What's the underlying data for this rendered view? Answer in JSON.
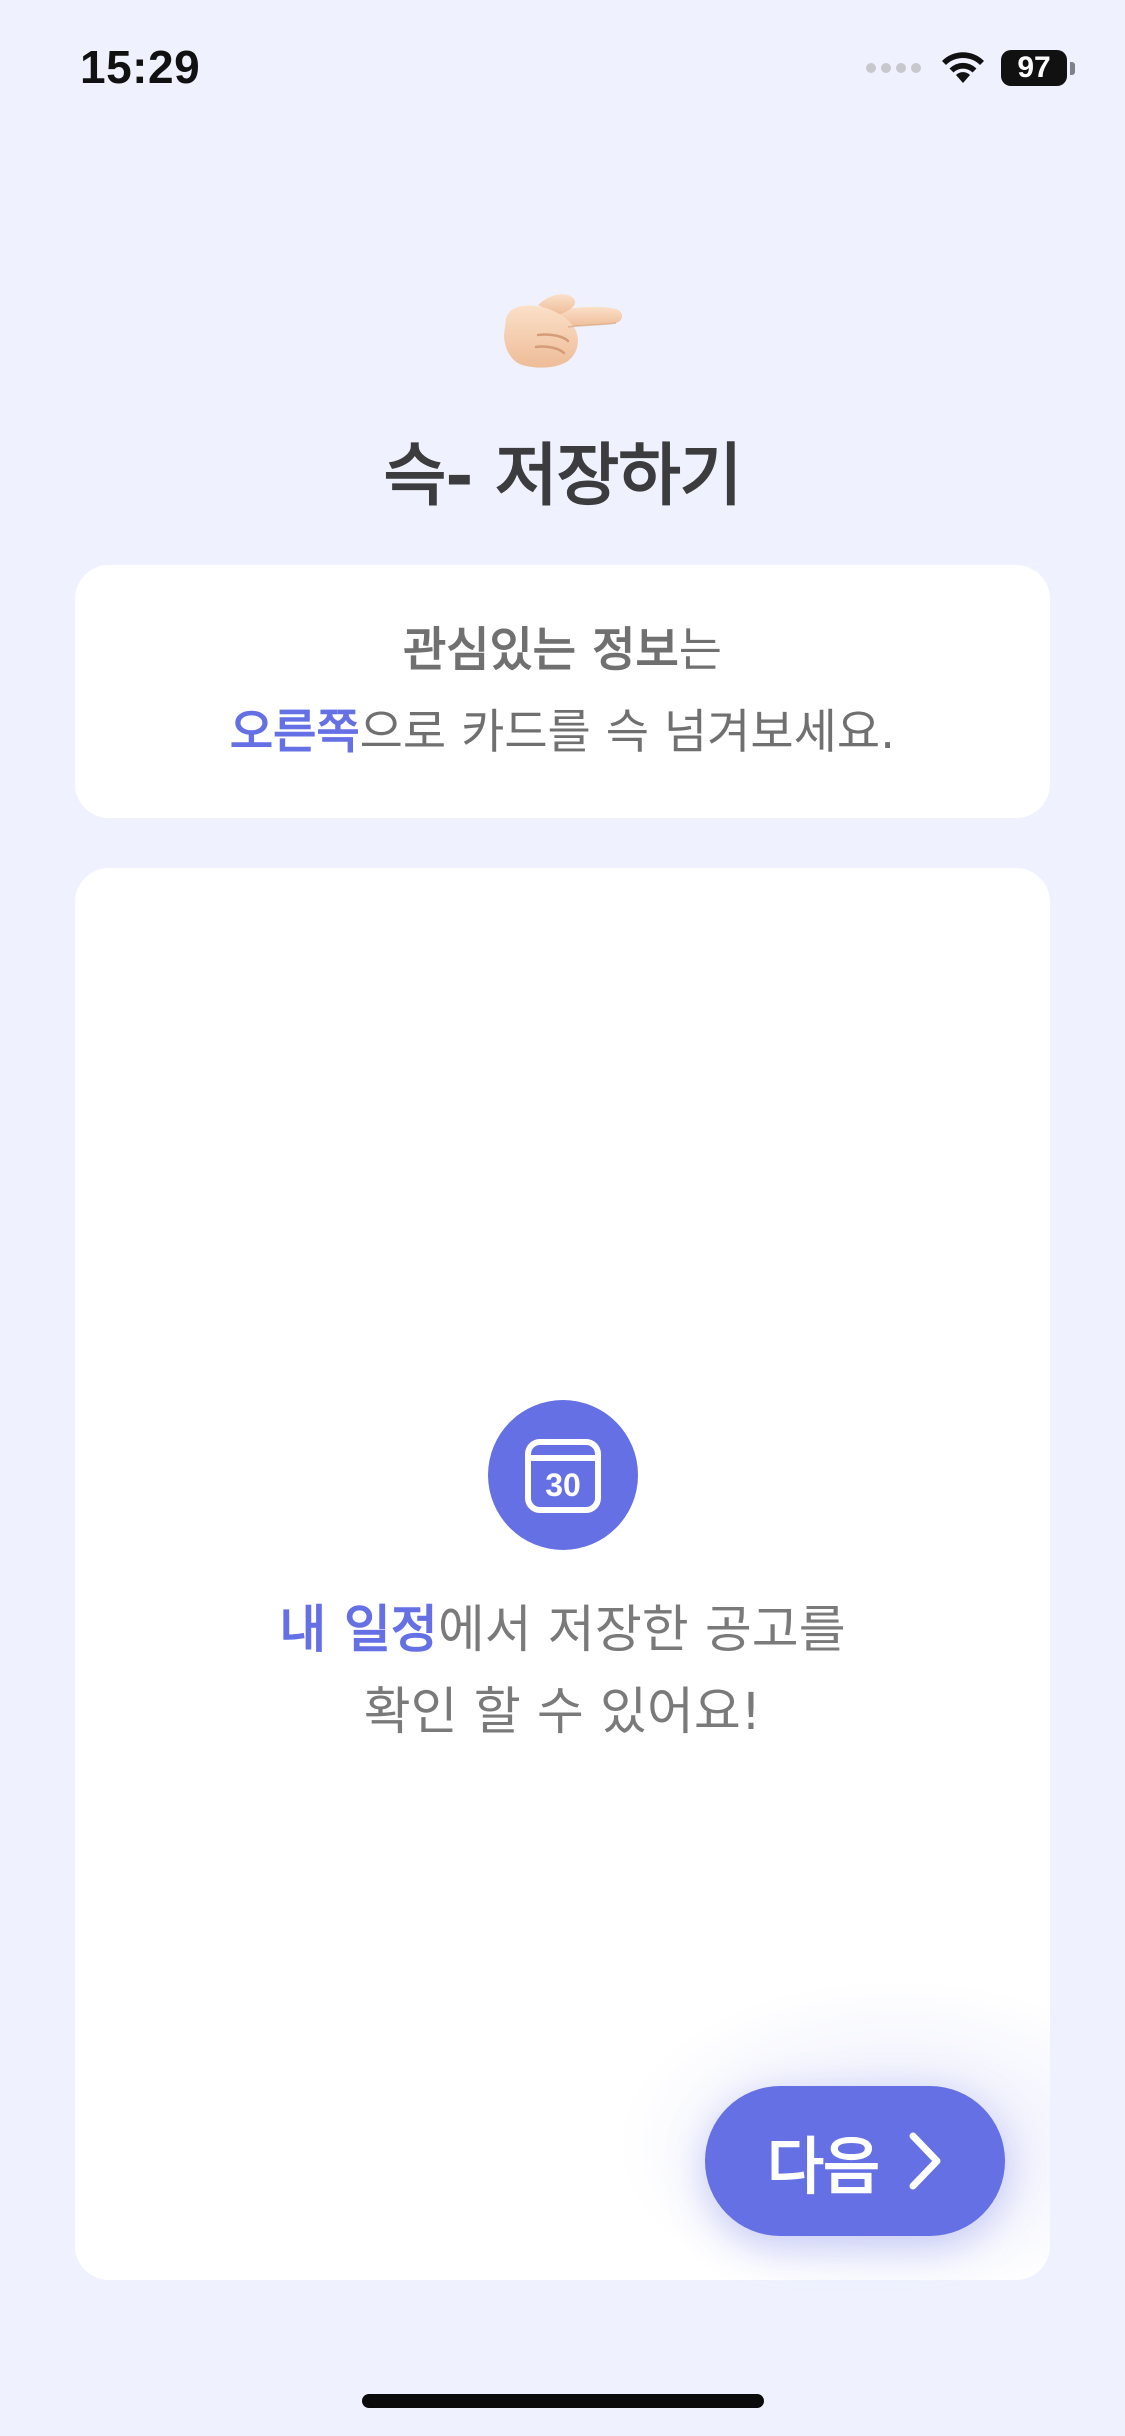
{
  "status_bar": {
    "time": "15:29",
    "battery_level": "97",
    "icons": [
      "cellular-signal-icon",
      "wifi-icon",
      "battery-icon"
    ]
  },
  "header": {
    "icon": "backhand-index-pointing-right-icon",
    "title": "슥- 저장하기"
  },
  "instruction": {
    "line1_bold": "관심있는 정보",
    "line1_rest": "는",
    "line2_accent": "오른쪽",
    "line2_rest": "으로 카드를 슥 넘겨보세요."
  },
  "demo_card": {
    "icon": "calendar-icon",
    "calendar_day": "30",
    "message_accent": "내 일정",
    "message_line1_rest": "에서 저장한 공고를",
    "message_line2": "확인 할 수 있어요!"
  },
  "next_button": {
    "label": "다음",
    "icon": "chevron-right-icon"
  },
  "colors": {
    "background": "#eff2fe",
    "card": "#ffffff",
    "accent": "#6470e4",
    "title_text": "#3c3c3e",
    "body_text": "#707070"
  }
}
